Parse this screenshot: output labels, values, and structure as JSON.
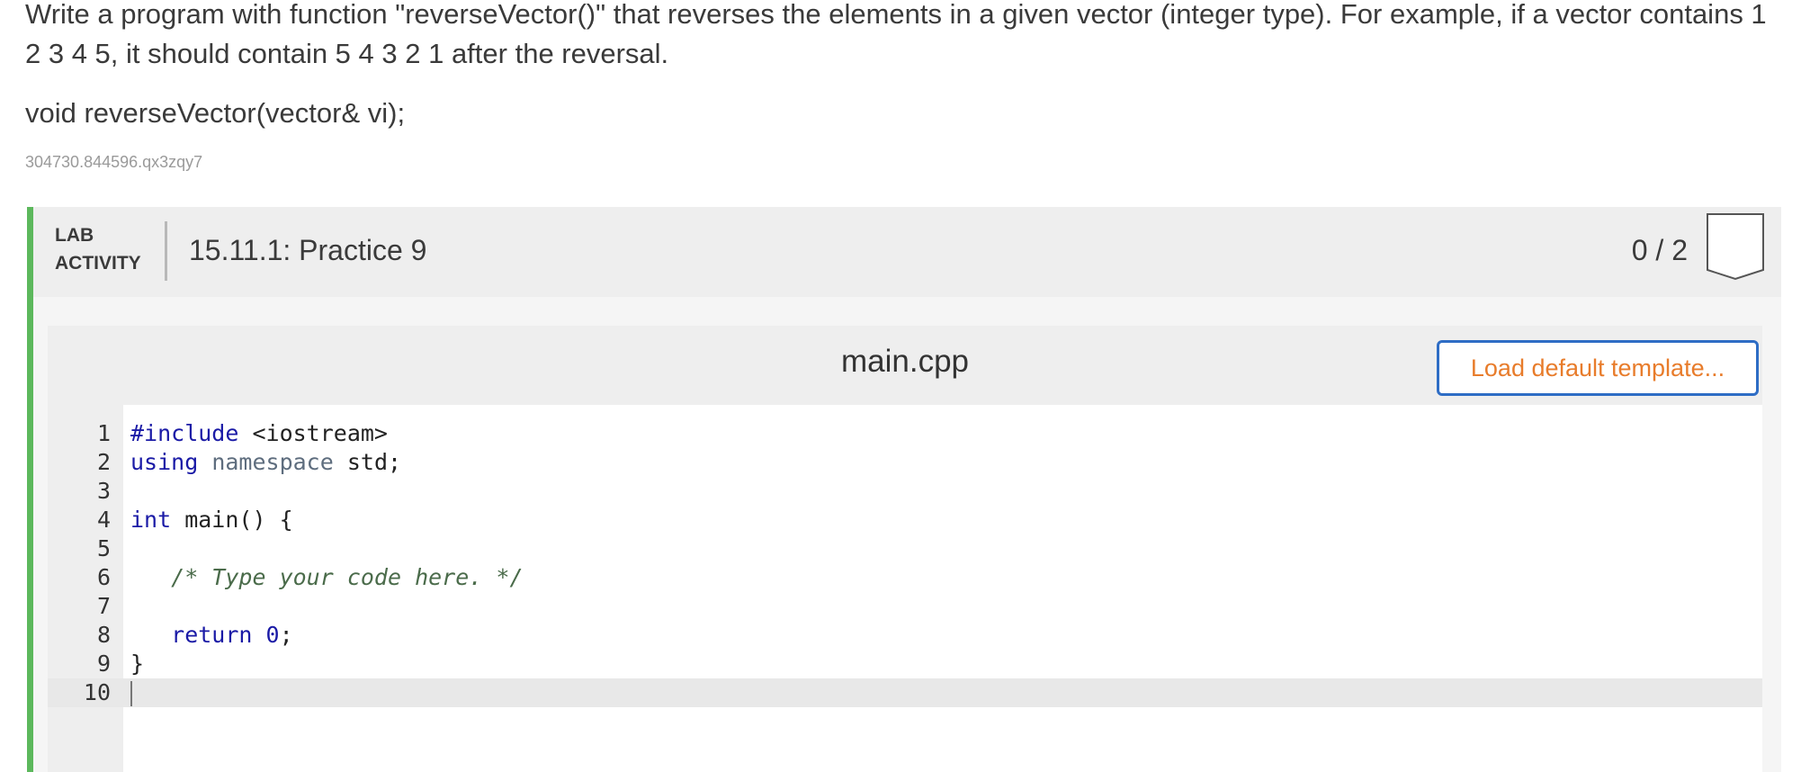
{
  "prompt": {
    "text": "Write a program with function \"reverseVector()\" that reverses the elements in a given vector (integer type). For example, if a vector contains 1 2 3 4 5, it should contain 5 4 3 2 1 after the reversal.",
    "signature": "void reverseVector(vector& vi);",
    "hash": "304730.844596.qx3zqy7"
  },
  "lab": {
    "label_line1": "LAB",
    "label_line2": "ACTIVITY",
    "title": "15.11.1: Practice 9",
    "score": "0 / 2",
    "accent_color": "#5cb85c"
  },
  "editor": {
    "filename": "main.cpp",
    "load_button_label": "Load default template...",
    "lines": [
      {
        "number": "1",
        "segments": [
          {
            "text": "#include",
            "cls": "kw"
          },
          {
            "text": " <iostream>",
            "cls": ""
          }
        ]
      },
      {
        "number": "2",
        "segments": [
          {
            "text": "using",
            "cls": "kw"
          },
          {
            "text": " ",
            "cls": ""
          },
          {
            "text": "namespace",
            "cls": "kw2"
          },
          {
            "text": " std;",
            "cls": ""
          }
        ]
      },
      {
        "number": "3",
        "segments": []
      },
      {
        "number": "4",
        "segments": [
          {
            "text": "int",
            "cls": "kw"
          },
          {
            "text": " main() {",
            "cls": ""
          }
        ]
      },
      {
        "number": "5",
        "segments": []
      },
      {
        "number": "6",
        "segments": [
          {
            "text": "   ",
            "cls": ""
          },
          {
            "text": "/* Type your code here. */",
            "cls": "comment"
          }
        ]
      },
      {
        "number": "7",
        "segments": []
      },
      {
        "number": "8",
        "segments": [
          {
            "text": "   ",
            "cls": ""
          },
          {
            "text": "return",
            "cls": "kw"
          },
          {
            "text": " ",
            "cls": ""
          },
          {
            "text": "0",
            "cls": "num"
          },
          {
            "text": ";",
            "cls": ""
          }
        ]
      },
      {
        "number": "9",
        "segments": [
          {
            "text": "}",
            "cls": ""
          }
        ]
      },
      {
        "number": "10",
        "segments": [],
        "active": true
      }
    ]
  }
}
